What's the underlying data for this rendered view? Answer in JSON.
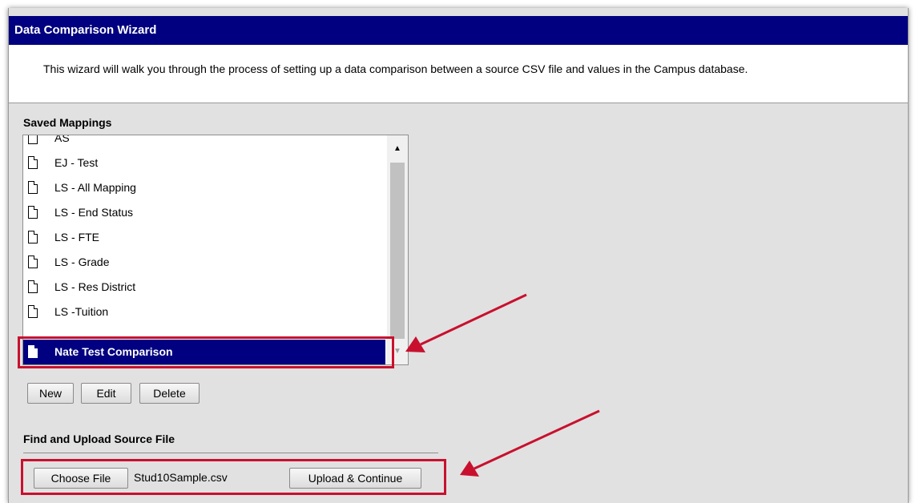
{
  "window": {
    "title": "Data Comparison Wizard"
  },
  "intro": {
    "text": "This wizard will walk you through the process of setting up a data comparison between a source CSV file and values in the Campus database."
  },
  "saved_mappings": {
    "label": "Saved Mappings",
    "items": [
      {
        "label": "AS",
        "icon": "document-icon"
      },
      {
        "label": "EJ - Test",
        "icon": "document-icon"
      },
      {
        "label": "LS - All Mapping",
        "icon": "document-icon"
      },
      {
        "label": "LS - End Status",
        "icon": "document-icon"
      },
      {
        "label": "LS - FTE",
        "icon": "document-icon"
      },
      {
        "label": "LS - Grade",
        "icon": "document-icon"
      },
      {
        "label": "LS - Res District",
        "icon": "document-icon"
      },
      {
        "label": "LS -Tuition",
        "icon": "document-icon"
      },
      {
        "label": "Nate Test Comparison",
        "icon": "document-icon",
        "selected": true
      }
    ],
    "buttons": {
      "new": "New",
      "edit": "Edit",
      "delete": "Delete"
    }
  },
  "upload": {
    "label": "Find and Upload Source File",
    "choose_button": "Choose File",
    "file_name": "Stud10Sample.csv",
    "upload_button": "Upload & Continue"
  },
  "colors": {
    "title_bar": "#000080",
    "selected_row": "#000080",
    "annotation": "#c8102e",
    "panel_background": "#e1e1e1"
  }
}
